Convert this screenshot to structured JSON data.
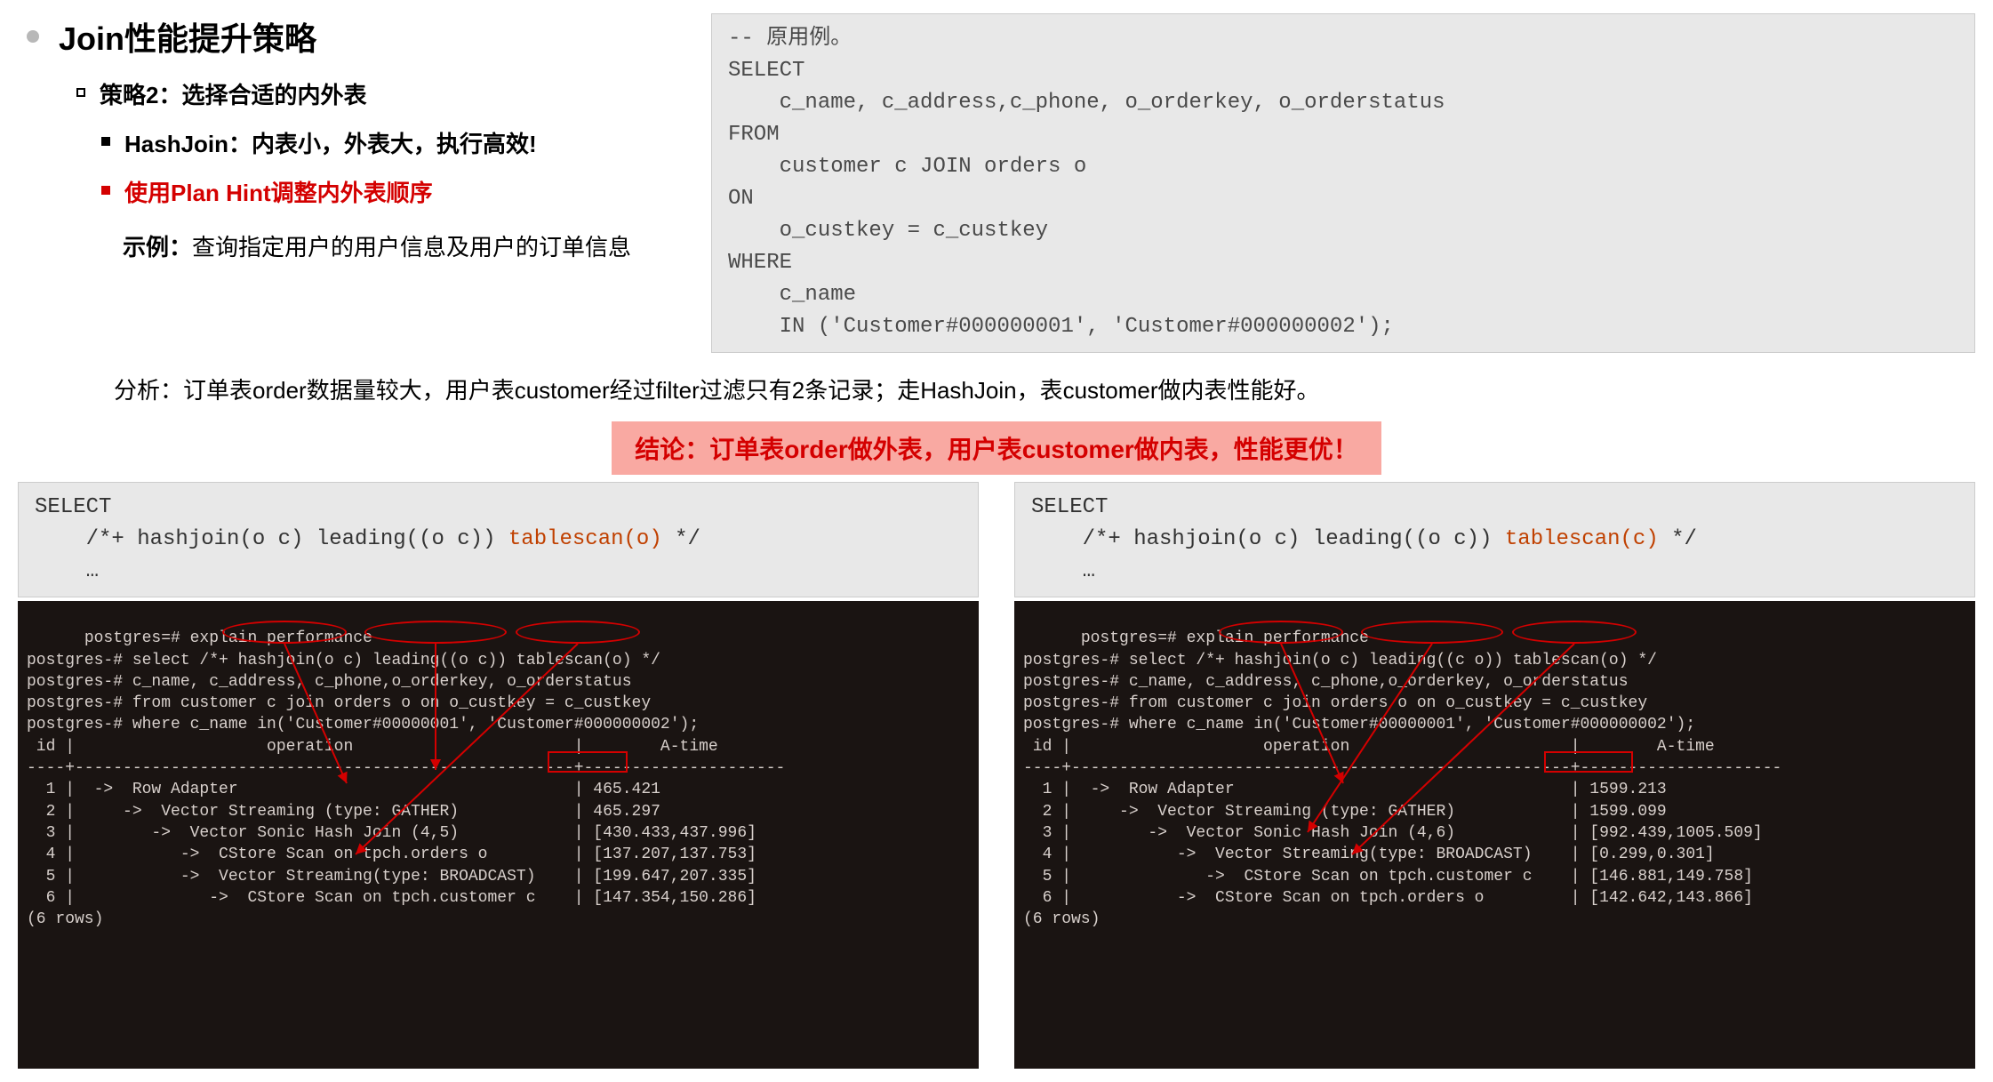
{
  "title": "Join性能提升策略",
  "strategy_label": "策略2：选择合适的内外表",
  "bullet_hashjoin": "HashJoin：内表小，外表大，执行高效!",
  "bullet_planhint": "使用Plan Hint调整内外表顺序",
  "example_label": "示例：",
  "example_text": "查询指定用户的用户信息及用户的订单信息",
  "analysis": "分析：订单表order数据量较大，用户表customer经过filter过滤只有2条记录；走HashJoin，表customer做内表性能好。",
  "conclusion": "结论：订单表order做外表，用户表customer做内表，性能更优！",
  "original_sql": "-- 原用例。\nSELECT\n    c_name, c_address,c_phone, o_orderkey, o_orderstatus\nFROM\n    customer c JOIN orders o\nON\n    o_custkey = c_custkey\nWHERE\n    c_name\n    IN ('Customer#000000001', 'Customer#000000002');",
  "left_plan": {
    "sql_pre": "SELECT\n    /*+ hashjoin(o c) leading((o c)) ",
    "sql_hl": "tablescan(o)",
    "sql_post": " */\n    …",
    "terminal": "postgres=# explain performance\npostgres-# select /*+ hashjoin(o c) leading((o c)) tablescan(o) */\npostgres-# c_name, c_address, c_phone,o_orderkey, o_orderstatus\npostgres-# from customer c join orders o on o_custkey = c_custkey\npostgres-# where c_name in('Customer#00000001', 'Customer#000000002');\n id |                    operation                       |        A-time\n----+----------------------------------------------------+---------------------\n  1 |  ->  Row Adapter                                   | 465.421\n  2 |     ->  Vector Streaming (type: GATHER)            | 465.297\n  3 |        ->  Vector Sonic Hash Join (4,5)            | [430.433,437.996]\n  4 |           ->  CStore Scan on tpch.orders o         | [137.207,137.753]\n  5 |           ->  Vector Streaming(type: BROADCAST)    | [199.647,207.335]\n  6 |              ->  CStore Scan on tpch.customer c    | [147.354,150.286]\n(6 rows)"
  },
  "right_plan": {
    "sql_pre": "SELECT\n    /*+ hashjoin(o c) leading((o c)) ",
    "sql_hl": "tablescan(c)",
    "sql_post": " */\n    …",
    "terminal": "postgres=# explain performance\npostgres-# select /*+ hashjoin(o c) leading((c o)) tablescan(o) */\npostgres-# c_name, c_address, c_phone,o_orderkey, o_orderstatus\npostgres-# from customer c join orders o on o_custkey = c_custkey\npostgres-# where c_name in('Customer#00000001', 'Customer#000000002');\n id |                    operation                       |        A-time\n----+----------------------------------------------------+---------------------\n  1 |  ->  Row Adapter                                   | 1599.213\n  2 |     ->  Vector Streaming (type: GATHER)            | 1599.099\n  3 |        ->  Vector Sonic Hash Join (4,6)            | [992.439,1005.509]\n  4 |           ->  Vector Streaming(type: BROADCAST)    | [0.299,0.301]\n  5 |              ->  CStore Scan on tpch.customer c    | [146.881,149.758]\n  6 |           ->  CStore Scan on tpch.orders o         | [142.642,143.866]\n(6 rows)"
  }
}
